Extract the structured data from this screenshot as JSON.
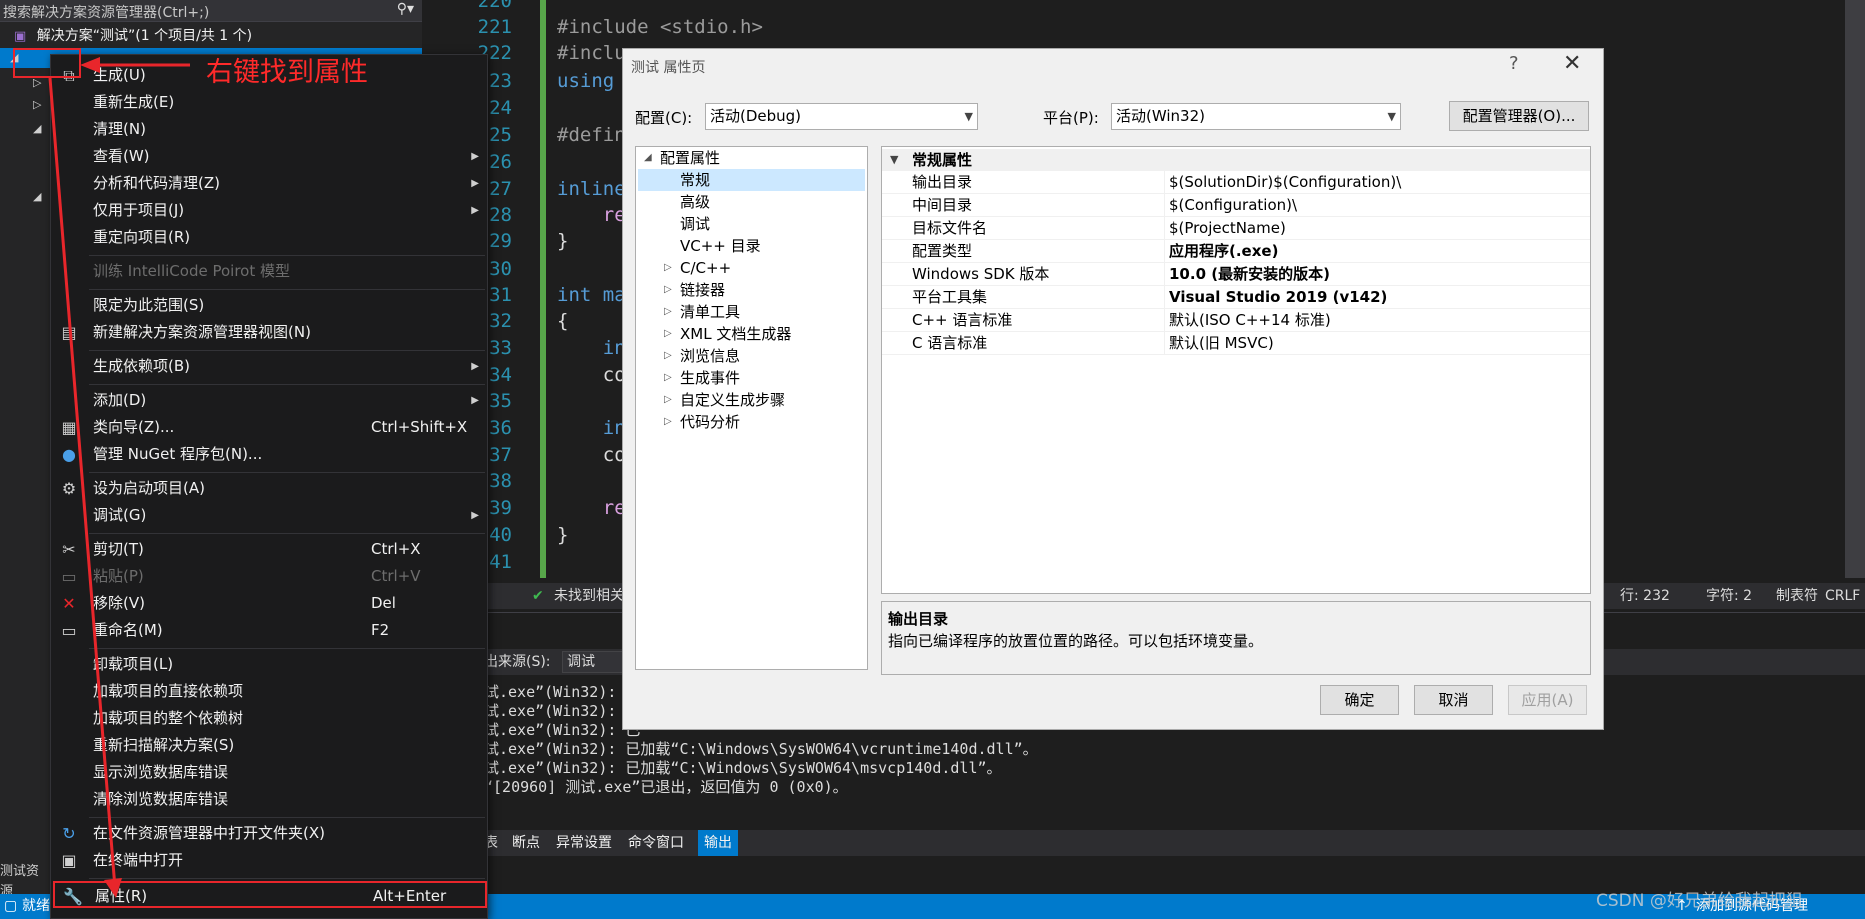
{
  "solution_explorer": {
    "search_placeholder": "搜索解决方案资源管理器(Ctrl+;)",
    "solution_label": "解决方案“测试”(1 个项目/共 1 个)",
    "tab_label": "测试资源"
  },
  "editor": {
    "line_numbers": [
      "220",
      "221",
      "222",
      "223",
      "224",
      "225",
      "226",
      "227",
      "228",
      "229",
      "230",
      "231",
      "232",
      "233",
      "234",
      "235",
      "236",
      "237",
      "238",
      "239",
      "240",
      "241"
    ],
    "code_lines": [
      {
        "text": "#include <stdio.h>"
      },
      {
        "text": "#inclu"
      },
      {
        "text": "using "
      },
      {
        "text": "#defin"
      },
      {
        "text": "inline"
      },
      {
        "text": "    re"
      },
      {
        "text": "}"
      },
      {
        "text": "int ma"
      },
      {
        "text": "{"
      },
      {
        "text": "    in"
      },
      {
        "text": "    co"
      },
      {
        "text": "    in"
      },
      {
        "text": "    co"
      },
      {
        "text": "    re"
      },
      {
        "text": "}"
      }
    ],
    "status": {
      "issues": "未找到相关",
      "line": "行: 232",
      "char": "字符: 2",
      "tab": "制表符",
      "crlf": "CRLF"
    }
  },
  "output": {
    "source_label": "显示输出来源(S):",
    "source_label_visible": "出来源(S):",
    "source_value": "调试",
    "lines": [
      "试.exe”(Win32): 已",
      "试.exe”(Win32): 已",
      "试.exe”(Win32): 已",
      "试.exe”(Win32): 已加载“C:\\Windows\\SysWOW64\\vcruntime140d.dll”。",
      "试.exe”(Win32): 已加载“C:\\Windows\\SysWOW64\\msvcp140d.dll”。",
      "“[20960] 测试.exe”已退出，返回值为 0 (0x0)。"
    ],
    "tabs": [
      "表",
      "断点",
      "异常设置",
      "命令窗口",
      "输出"
    ]
  },
  "statusbar": {
    "left": "就绪",
    "right": "添加到源代码管理"
  },
  "annotation": {
    "text": "右键找到属性"
  },
  "context_menu": {
    "items": [
      {
        "label": "生成(U)",
        "shortcut": "",
        "icon": "build-icon"
      },
      {
        "label": "重新生成(E)",
        "shortcut": ""
      },
      {
        "label": "清理(N)",
        "shortcut": ""
      },
      {
        "label": "查看(W)",
        "shortcut": "",
        "submenu": true
      },
      {
        "label": "分析和代码清理(Z)",
        "shortcut": "",
        "submenu": true
      },
      {
        "label": "仅用于项目(J)",
        "shortcut": "",
        "submenu": true
      },
      {
        "label": "重定向项目(R)",
        "shortcut": ""
      },
      {
        "label": "训练 IntelliCode Poirot 模型",
        "shortcut": "",
        "disabled": true
      },
      {
        "label": "限定为此范围(S)",
        "shortcut": ""
      },
      {
        "label": "新建解决方案资源管理器视图(N)",
        "shortcut": "",
        "icon": "new-view-icon"
      },
      {
        "label": "生成依赖项(B)",
        "shortcut": "",
        "submenu": true
      },
      {
        "label": "添加(D)",
        "shortcut": "",
        "submenu": true
      },
      {
        "label": "类向导(Z)...",
        "shortcut": "Ctrl+Shift+X",
        "icon": "class-wizard-icon"
      },
      {
        "label": "管理 NuGet 程序包(N)...",
        "shortcut": "",
        "icon": "nuget-icon"
      },
      {
        "label": "设为启动项目(A)",
        "shortcut": "",
        "icon": "gear-icon"
      },
      {
        "label": "调试(G)",
        "shortcut": "",
        "submenu": true
      },
      {
        "label": "剪切(T)",
        "shortcut": "Ctrl+X",
        "icon": "scissors-icon"
      },
      {
        "label": "粘贴(P)",
        "shortcut": "Ctrl+V",
        "disabled": true,
        "icon": "paste-icon"
      },
      {
        "label": "移除(V)",
        "shortcut": "Del",
        "icon": "remove-icon"
      },
      {
        "label": "重命名(M)",
        "shortcut": "F2",
        "icon": "rename-icon"
      },
      {
        "label": "卸载项目(L)",
        "shortcut": ""
      },
      {
        "label": "加载项目的直接依赖项",
        "shortcut": ""
      },
      {
        "label": "加载项目的整个依赖树",
        "shortcut": ""
      },
      {
        "label": "重新扫描解决方案(S)",
        "shortcut": ""
      },
      {
        "label": "显示浏览数据库错误",
        "shortcut": ""
      },
      {
        "label": "清除浏览数据库错误",
        "shortcut": ""
      },
      {
        "label": "在文件资源管理器中打开文件夹(X)",
        "shortcut": "",
        "icon": "open-folder-icon"
      },
      {
        "label": "在终端中打开",
        "shortcut": "",
        "icon": "terminal-icon"
      },
      {
        "label": "属性(R)",
        "shortcut": "Alt+Enter",
        "icon": "wrench-icon"
      }
    ]
  },
  "dialog": {
    "title": "测试 属性页",
    "help": "?",
    "close": "✕",
    "config_label": "配置(C):",
    "config_value": "活动(Debug)",
    "platform_label": "平台(P):",
    "platform_value": "活动(Win32)",
    "config_manager": "配置管理器(O)...",
    "tree": [
      {
        "label": "配置属性",
        "level": 0,
        "expanded": true
      },
      {
        "label": "常规",
        "level": 1,
        "selected": true
      },
      {
        "label": "高级",
        "level": 1
      },
      {
        "label": "调试",
        "level": 1
      },
      {
        "label": "VC++ 目录",
        "level": 1
      },
      {
        "label": "C/C++",
        "level": 1,
        "collapsed": true
      },
      {
        "label": "链接器",
        "level": 1,
        "collapsed": true
      },
      {
        "label": "清单工具",
        "level": 1,
        "collapsed": true
      },
      {
        "label": "XML 文档生成器",
        "level": 1,
        "collapsed": true
      },
      {
        "label": "浏览信息",
        "level": 1,
        "collapsed": true
      },
      {
        "label": "生成事件",
        "level": 1,
        "collapsed": true
      },
      {
        "label": "自定义生成步骤",
        "level": 1,
        "collapsed": true
      },
      {
        "label": "代码分析",
        "level": 1,
        "collapsed": true
      }
    ],
    "grid_header": "常规属性",
    "properties": [
      {
        "name": "输出目录",
        "value": "$(SolutionDir)$(Configuration)\\",
        "bold": false
      },
      {
        "name": "中间目录",
        "value": "$(Configuration)\\",
        "bold": false
      },
      {
        "name": "目标文件名",
        "value": "$(ProjectName)",
        "bold": false
      },
      {
        "name": "配置类型",
        "value": "应用程序(.exe)",
        "bold": true
      },
      {
        "name": "Windows SDK 版本",
        "value": "10.0 (最新安装的版本)",
        "bold": true
      },
      {
        "name": "平台工具集",
        "value": "Visual Studio 2019 (v142)",
        "bold": true
      },
      {
        "name": "C++ 语言标准",
        "value": "默认(ISO C++14 标准)",
        "bold": false
      },
      {
        "name": "C 语言标准",
        "value": "默认(旧 MSVC)",
        "bold": false
      }
    ],
    "desc_title": "输出目录",
    "desc_text": "指向已编译程序的放置位置的路径。可以包括环境变量。",
    "ok": "确定",
    "cancel": "取消",
    "apply": "应用(A)"
  },
  "watermark": "CSDN @好兄弟给我起把狙"
}
